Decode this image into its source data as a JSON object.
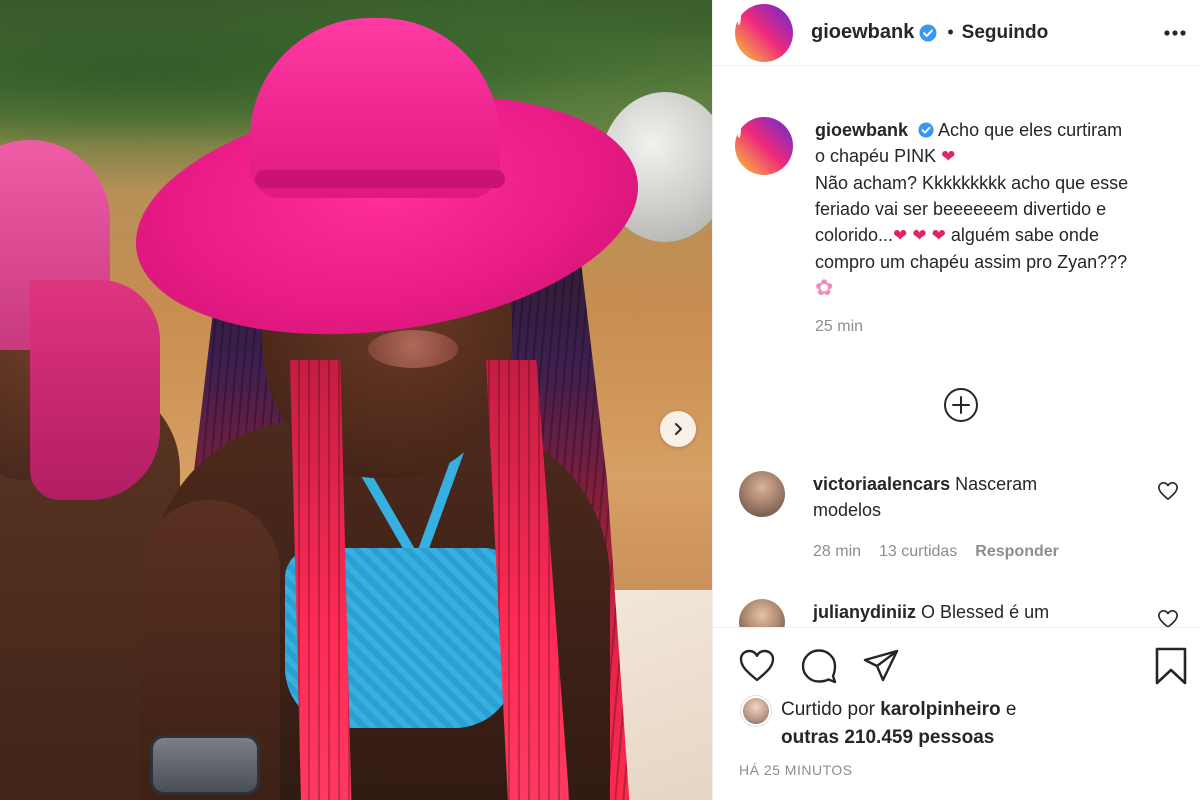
{
  "post": {
    "username": "gioewbank",
    "follow_status": "Seguindo",
    "caption_lines": [
      "Acho que eles curtiram",
      "o chapéu PINK",
      "Não acham? Kkkkkkkkk acho que esse",
      "feriado vai ser beeeeeem divertido e",
      "colorido...",
      "alguém sabe onde",
      "compro um chapéu assim pro Zyan???"
    ],
    "caption_time": "25 min",
    "emojis": {
      "heart": "❤",
      "flower": "✿"
    }
  },
  "comments": [
    {
      "username": "victoriaalencars",
      "text_1": "Nasceram",
      "text_2": "modelos",
      "time": "28 min",
      "likes": "13 curtidas",
      "reply": "Responder"
    },
    {
      "username": "julianydiniiz",
      "text_1": "O Blessed é um"
    }
  ],
  "footer": {
    "liked_by_prefix": "Curtido por",
    "liked_by_user": "karolpinheiro",
    "liked_by_and": "e",
    "others": "outras 210.459 pessoas",
    "date": "HÁ 25 MINUTOS"
  },
  "colors": {
    "text": "#262626",
    "muted": "#8e8e8e",
    "verified": "#3897f0",
    "heart_red": "#e0245e",
    "hat_pink": "#e81a85"
  },
  "icons": [
    "verified-badge-icon",
    "more-options-icon",
    "chevron-right-icon",
    "plus-circle-icon",
    "heart-icon",
    "comment-icon",
    "share-icon",
    "bookmark-icon"
  ]
}
